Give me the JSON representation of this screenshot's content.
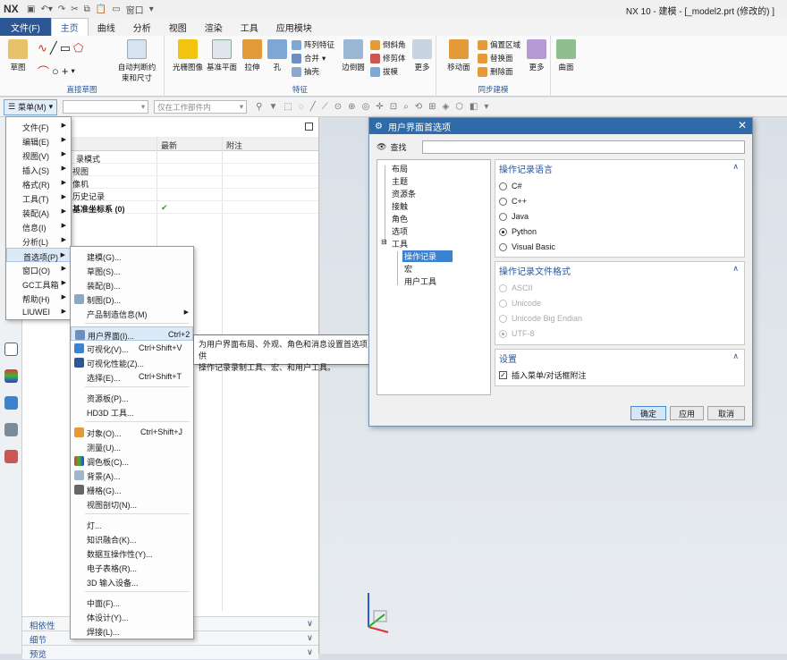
{
  "app": {
    "logo": "NX",
    "window_title": "NX 10 - 建模 - [_model2.prt  (修改的) ]",
    "quick_access_window": "窗口"
  },
  "tabs": [
    "文件(F)",
    "主页",
    "曲线",
    "分析",
    "视图",
    "渲染",
    "工具",
    "应用模块"
  ],
  "ribbon": {
    "sketch": "草图",
    "direct_sketch_group": "直接草图",
    "auto_constraint": "自动判断约束和尺寸",
    "raster_image": "光栅图像",
    "datum_plane": "基准平面",
    "extrude": "拉伸",
    "hole": "孔",
    "pattern_feature": "阵列特征",
    "unite": "合并",
    "shell": "抽壳",
    "edge_blend": "边倒圆",
    "chamfer": "倒斜角",
    "trim_body": "修剪体",
    "draft": "拔模",
    "more1": "更多",
    "feature_group": "特征",
    "move_face": "移动面",
    "offset_region": "偏置区域",
    "replace_face": "替换面",
    "delete_face": "删除面",
    "more2": "更多",
    "sync_group": "同步建模",
    "surface": "曲面"
  },
  "cmdbar": {
    "menu_label": "菜单(M)",
    "filter_value": "",
    "scope_value": "仅在工作部件内"
  },
  "navigator": {
    "col_latest": "最新",
    "col_note": "附注",
    "rows": [
      "录模式",
      "视图",
      "像机",
      "历史记录",
      "基准坐标系 (0)"
    ],
    "dependencies": "相依性",
    "details": "细节",
    "preview": "预览"
  },
  "main_menu": [
    {
      "label": "文件(F)",
      "arrow": "▶"
    },
    {
      "label": "编辑(E)",
      "arrow": "▶"
    },
    {
      "label": "视图(V)",
      "arrow": "▶"
    },
    {
      "label": "插入(S)",
      "arrow": "▶"
    },
    {
      "label": "格式(R)",
      "arrow": "▶"
    },
    {
      "label": "工具(T)",
      "arrow": "▶"
    },
    {
      "label": "装配(A)",
      "arrow": "▶"
    },
    {
      "label": "信息(I)",
      "arrow": "▶"
    },
    {
      "label": "分析(L)",
      "arrow": "▶"
    },
    {
      "label": "首选项(P)",
      "arrow": "▶"
    },
    {
      "label": "窗口(O)",
      "arrow": "▶"
    },
    {
      "label": "GC工具箱",
      "arrow": "▶"
    },
    {
      "label": "帮助(H)",
      "arrow": "▶"
    },
    {
      "label": "LIUWEI",
      "arrow": "▶"
    }
  ],
  "pref_menu": {
    "modeling": "建模(G)...",
    "sketch": "草图(S)...",
    "assembly": "装配(B)...",
    "drafting": "制图(D)...",
    "pmi": "产品制造信息(M)",
    "pmi_arrow": "▶",
    "ui": "用户界面(I)...",
    "ui_sc": "Ctrl+2",
    "visualization": "可视化(V)...",
    "visualization_sc": "Ctrl+Shift+V",
    "vis_perf": "可视化性能(Z)...",
    "selection": "选择(E)...",
    "selection_sc": "Ctrl+Shift+T",
    "resource_bar": "资源板(P)...",
    "hd3d": "HD3D 工具...",
    "object": "对象(O)...",
    "object_sc": "Ctrl+Shift+J",
    "measure": "测量(U)...",
    "palette": "调色板(C)...",
    "background": "背景(A)...",
    "grid": "栅格(G)...",
    "view_section": "视图剖切(N)...",
    "light": "灯...",
    "knowledge_fusion": "知识融合(K)...",
    "interop": "数据互操作性(Y)...",
    "spreadsheet": "电子表格(R)...",
    "input_3d": "3D 输入设备...",
    "chinese": "中面(F)...",
    "body_design": "体设计(Y)...",
    "weld": "焊接(L)..."
  },
  "tooltip": {
    "line1": "为用户界面布局、外观、角色和消息设置首选项，并提供",
    "line2": "操作记录录制工具、宏、和用户工具。"
  },
  "dialog": {
    "title": "用户界面首选项",
    "close": "✕",
    "find_label": "查找",
    "tree": [
      "布局",
      "主题",
      "资源条",
      "接触",
      "角色",
      "选项",
      "工具",
      "操作记录",
      "宏",
      "用户工具"
    ],
    "journal_lang_title": "操作记录语言",
    "languages": [
      "C#",
      "C++",
      "Java",
      "Python",
      "Visual Basic"
    ],
    "selected_language": "Python",
    "journal_format_title": "操作记录文件格式",
    "formats": [
      "ASCII",
      "Unicode",
      "Unicode Big Endian",
      "UTF-8"
    ],
    "selected_format": "UTF-8",
    "settings_title": "设置",
    "insert_menu_note": "插入菜单/对话框附注",
    "insert_menu_checked": true,
    "ok": "确定",
    "apply": "应用",
    "cancel": "取消"
  },
  "colors": {
    "accent": "#2b5797",
    "dialog_title": "#2f6ba8",
    "selection": "#3b82d1"
  }
}
